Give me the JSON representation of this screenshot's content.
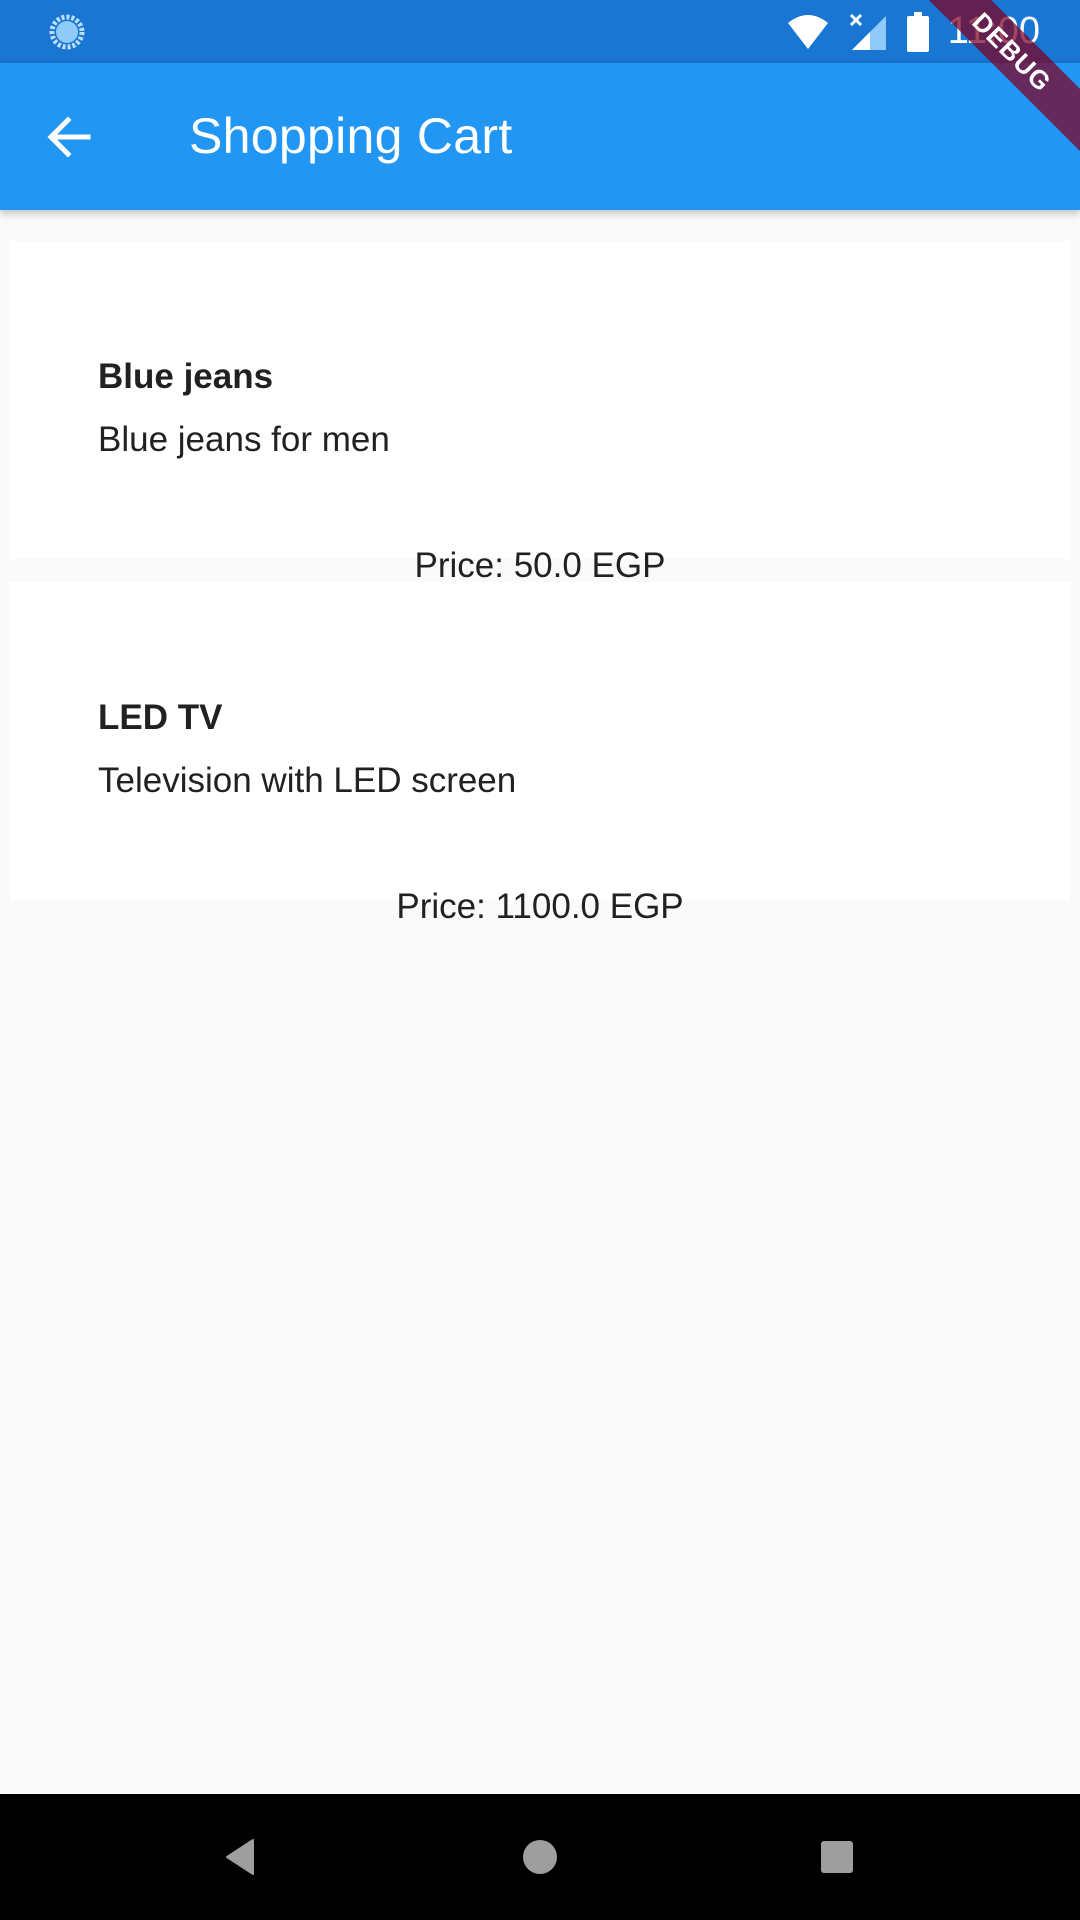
{
  "status_bar": {
    "time": "11:00",
    "icons": [
      "sync-icon",
      "wifi-icon",
      "signal-icon",
      "battery-icon"
    ]
  },
  "debug_banner": "DEBUG",
  "app_bar": {
    "title": "Shopping Cart",
    "back_icon": "arrow-back-icon",
    "color": "#2196f3",
    "status_color": "#1976d2"
  },
  "cart": {
    "items": [
      {
        "name": "Blue jeans",
        "description": "Blue jeans for men",
        "price": "Price: 50.0 EGP"
      },
      {
        "name": "LED TV",
        "description": "Television with LED screen",
        "price": "Price: 1100.0 EGP"
      }
    ]
  },
  "nav_bar": {
    "buttons": [
      "back-triangle-icon",
      "home-circle-icon",
      "recents-square-icon"
    ]
  }
}
